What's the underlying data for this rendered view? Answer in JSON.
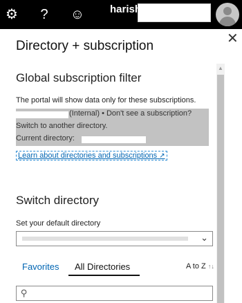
{
  "topbar": {
    "username": "harish",
    "icons": [
      "gear-icon",
      "help-icon",
      "smiley-icon",
      "avatar-icon"
    ]
  },
  "panel": {
    "title": "Directory + subscription",
    "close_icon": "close-icon"
  },
  "global_filter": {
    "heading": "Global subscription filter",
    "description": "The portal will show data only for these subscriptions.",
    "line1": "(Internal) • Don't see a subscription?",
    "line2": "Switch to another directory.",
    "line3": "Current directory:",
    "learn_link": "Learn about directories and subscriptions"
  },
  "switch_directory": {
    "heading": "Switch directory",
    "default_label": "Set your default directory",
    "dropdown_chevron": "chevron-down-icon"
  },
  "tabs": {
    "favorites": "Favorites",
    "all": "All Directories",
    "active": "All Directories",
    "sort_label": "A to Z"
  },
  "search": {
    "placeholder": ""
  }
}
